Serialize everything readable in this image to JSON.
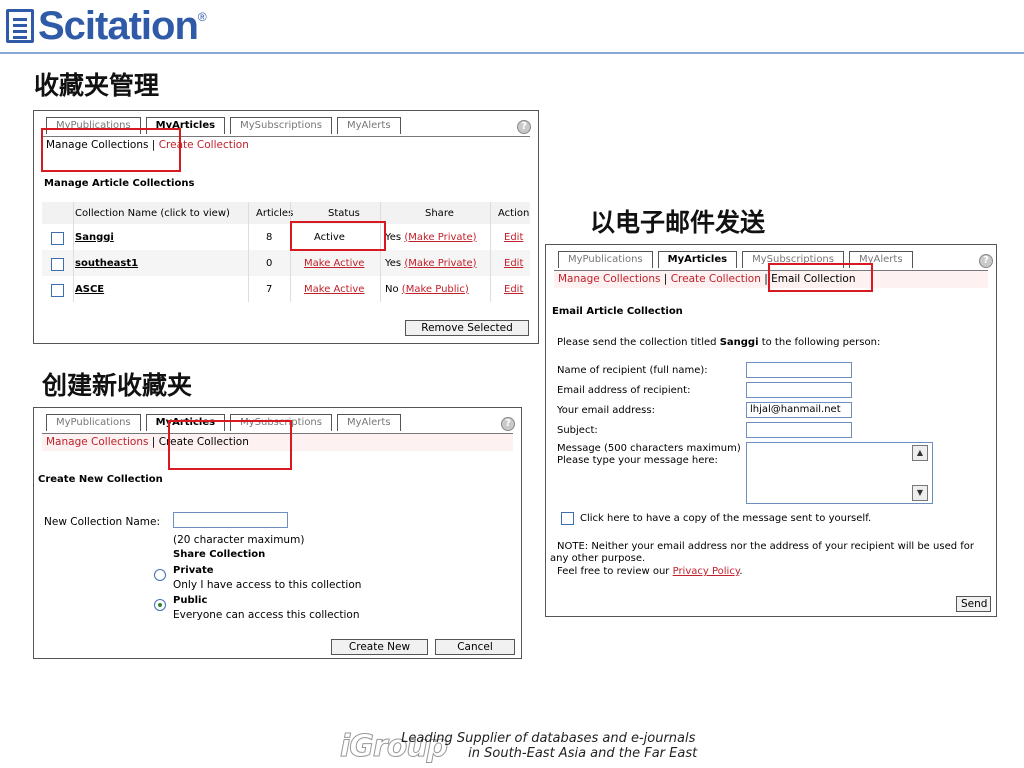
{
  "brand": {
    "name": "Scitation",
    "mark": "®"
  },
  "headings": {
    "manage": "收藏夹管理",
    "email": "以电子邮件发送",
    "create": "创建新收藏夹"
  },
  "tabs": [
    "MyPublications",
    "MyArticles",
    "MySubscriptions",
    "MyAlerts"
  ],
  "help_glyph": "?",
  "panel1": {
    "nav": {
      "manage": "Manage Collections",
      "sep": "|",
      "create": "Create Collection"
    },
    "title": "Manage Article Collections",
    "columns": [
      "Collection Name (click to view)",
      "Articles",
      "Status",
      "Share",
      "Action"
    ],
    "rows": [
      {
        "name": "Sanggi",
        "articles": "8",
        "status": "Active",
        "share_label": "Yes",
        "share_link": "(Make Private)",
        "action": "Edit"
      },
      {
        "name": "southeast1",
        "articles": "0",
        "status": "Make Active",
        "share_label": "Yes",
        "share_link": "(Make Private)",
        "action": "Edit"
      },
      {
        "name": "ASCE",
        "articles": "7",
        "status": "Make Active",
        "share_label": "No",
        "share_link": "(Make Public)",
        "action": "Edit"
      }
    ],
    "remove_button": "Remove Selected"
  },
  "panel2": {
    "nav": {
      "manage": "Manage Collections",
      "sep": "|",
      "create": "Create Collection"
    },
    "title": "Create New Collection",
    "name_label": "New Collection Name:",
    "name_value": "",
    "hint": "(20 character maximum)",
    "share_heading": "Share Collection",
    "private_label": "Private",
    "private_desc": "Only I have access to this collection",
    "public_label": "Public",
    "public_desc": "Everyone can access this collection",
    "selected": "Public",
    "create_button": "Create New",
    "cancel_button": "Cancel"
  },
  "panel3": {
    "nav": {
      "manage": "Manage Collections",
      "sep1": "|",
      "create": "Create Collection",
      "sep2": "|",
      "email": "Email Collection"
    },
    "title": "Email Article Collection",
    "intro_pre": "Please send the collection titled",
    "intro_name": "Sanggi",
    "intro_post": "to the following person:",
    "fields": {
      "recipient_name": {
        "label": "Name of recipient (full name):",
        "value": ""
      },
      "recipient_email": {
        "label": "Email address of recipient:",
        "value": ""
      },
      "your_email": {
        "label": "Your email address:",
        "value": "lhjal@hanmail.net"
      },
      "subject": {
        "label": "Subject:",
        "value": ""
      }
    },
    "message_label1": "Message (500 characters maximum)",
    "message_label2": "Please type your message here:",
    "copy_label": "Click here to have a copy of the message sent to yourself.",
    "note1": "NOTE: Neither your email address nor the address of your recipient will be used for",
    "note2": "any other purpose.",
    "note3_pre": "Feel free to review our",
    "note3_link": "Privacy Policy",
    "note3_post": ".",
    "send_button": "Send"
  },
  "footer": {
    "logo": "iGroup",
    "line1": "Leading Supplier of databases and e-journals",
    "line2": "in South-East Asia and the Far East"
  },
  "colors": {
    "brand": "#2f5aa8",
    "link": "#c0212b",
    "highlight": "#d71920"
  }
}
